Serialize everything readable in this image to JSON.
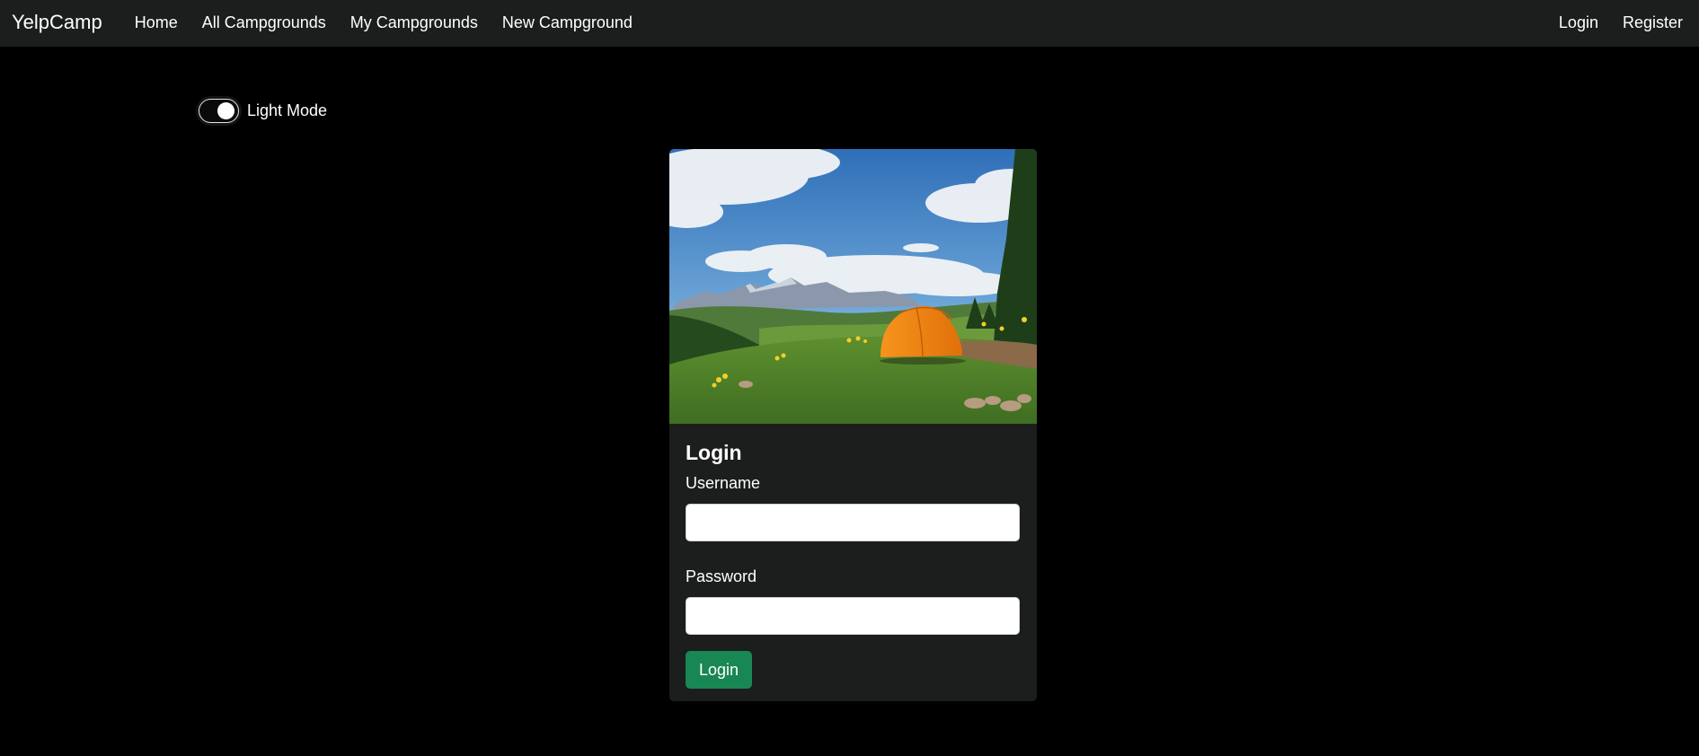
{
  "navbar": {
    "brand": "YelpCamp",
    "links": [
      {
        "label": "Home"
      },
      {
        "label": "All Campgrounds"
      },
      {
        "label": "My Campgrounds"
      },
      {
        "label": "New Campground"
      }
    ],
    "right_links": [
      {
        "label": "Login"
      },
      {
        "label": "Register"
      }
    ]
  },
  "theme_toggle": {
    "label": "Light Mode",
    "checked": true
  },
  "login_card": {
    "image": {
      "icon": "campsite-photo",
      "alt": "Orange tent on a grassy hill with mountains"
    },
    "title": "Login",
    "username": {
      "label": "Username",
      "value": "",
      "placeholder": ""
    },
    "password": {
      "label": "Password",
      "value": "",
      "placeholder": ""
    },
    "submit_label": "Login"
  },
  "colors": {
    "page_background": "#000000",
    "navbar_background": "#1c1d1d",
    "card_background": "#1c1d1d",
    "button_success": "#198754",
    "text": "#ffffff"
  }
}
